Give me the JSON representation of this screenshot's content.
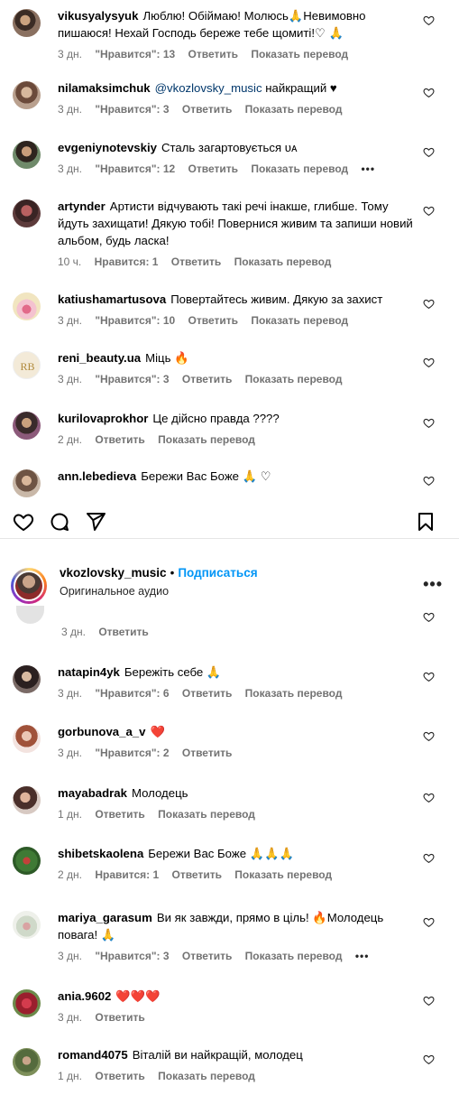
{
  "top_comments": [
    {
      "user": "vikusyalysyuk",
      "text": "Люблю! Обіймаю! Молюсь🙏Невимовно пишаюся! Нехай Господь береже тебе щомиті!♡ 🙏",
      "time": "3 дн.",
      "likes": "\"Нравится\": 13",
      "reply": "Ответить",
      "translate": "Показать перевод",
      "more": ""
    },
    {
      "user": "nilamaksimchuk",
      "mention": "@vkozlovsky_music",
      "text": " найкращий ♥",
      "time": "3 дн.",
      "likes": "\"Нравится\": 3",
      "reply": "Ответить",
      "translate": "Показать перевод",
      "more": ""
    },
    {
      "user": "evgeniynotevskiy",
      "text": "Сталь загартовується ᴜᴀ",
      "time": "3 дн.",
      "likes": "\"Нравится\": 12",
      "reply": "Ответить",
      "translate": "Показать перевод",
      "more": "•••"
    },
    {
      "user": "artynder",
      "text": "Артисти відчувають такі речі інакше, глибше. Тому йдуть захищати! Дякую тобі! Повернися живим та запиши новий альбом, будь ласка!",
      "time": "10 ч.",
      "likes": "Нравится: 1",
      "reply": "Ответить",
      "translate": "Показать перевод",
      "more": ""
    },
    {
      "user": "katiushamartusova",
      "text": "Повертайтесь живим. Дякую за захист",
      "time": "3 дн.",
      "likes": "\"Нравится\": 10",
      "reply": "Ответить",
      "translate": "Показать перевод",
      "more": ""
    },
    {
      "user": "reni_beauty.ua",
      "text": "Міць 🔥",
      "time": "3 дн.",
      "likes": "\"Нравится\": 3",
      "reply": "Ответить",
      "translate": "Показать перевод",
      "more": ""
    },
    {
      "user": "kurilovaprokhor",
      "text": "Це дійсно правда ????",
      "time": "2 дн.",
      "likes": "",
      "reply": "Ответить",
      "translate": "Показать перевод",
      "more": ""
    },
    {
      "user": "ann.lebedieva",
      "text": "Бережи Вас Боже 🙏 ♡",
      "time": "",
      "likes": "",
      "reply": "",
      "translate": "",
      "more": ""
    }
  ],
  "post_header": {
    "username": "vkozlovsky_music",
    "separator": "•",
    "follow": "Подписаться",
    "audio": "Оригинальное аудио",
    "menu": "•••"
  },
  "partial_meta": {
    "time": "3 дн.",
    "reply": "Ответить"
  },
  "bottom_comments": [
    {
      "user": "natapin4yk",
      "text": "Бережіть себе 🙏",
      "time": "3 дн.",
      "likes": "\"Нравится\": 6",
      "reply": "Ответить",
      "translate": "Показать перевод",
      "more": ""
    },
    {
      "user": "gorbunova_a_v",
      "text": "❤️",
      "time": "3 дн.",
      "likes": "\"Нравится\": 2",
      "reply": "Ответить",
      "translate": "",
      "more": ""
    },
    {
      "user": "mayabadrak",
      "text": "Молодець",
      "time": "1 дн.",
      "likes": "",
      "reply": "Ответить",
      "translate": "Показать перевод",
      "more": ""
    },
    {
      "user": "shibetskaolena",
      "text": "Бережи Вас Боже 🙏🙏🙏",
      "time": "2 дн.",
      "likes": "Нравится: 1",
      "reply": "Ответить",
      "translate": "Показать перевод",
      "more": ""
    },
    {
      "user": "mariya_garasum",
      "text": "Ви як завжди, прямо в ціль! 🔥Молодець повага! 🙏",
      "time": "3 дн.",
      "likes": "\"Нравится\": 3",
      "reply": "Ответить",
      "translate": "Показать перевод",
      "more": "•••"
    },
    {
      "user": "ania.9602",
      "text": "❤️❤️❤️",
      "time": "3 дн.",
      "likes": "",
      "reply": "Ответить",
      "translate": "",
      "more": ""
    },
    {
      "user": "romand4075",
      "text": "Віталій ви найкращій, молодец",
      "time": "1 дн.",
      "likes": "",
      "reply": "Ответить",
      "translate": "Показать перевод",
      "more": ""
    }
  ],
  "icons": {
    "like": "heart-outline-icon",
    "comment": "comment-bubble-icon",
    "share": "paper-plane-icon",
    "save": "bookmark-icon",
    "comment_like": "small-heart-icon"
  },
  "colors": {
    "link": "#00376b",
    "follow": "#0095f6",
    "muted": "#737373"
  }
}
